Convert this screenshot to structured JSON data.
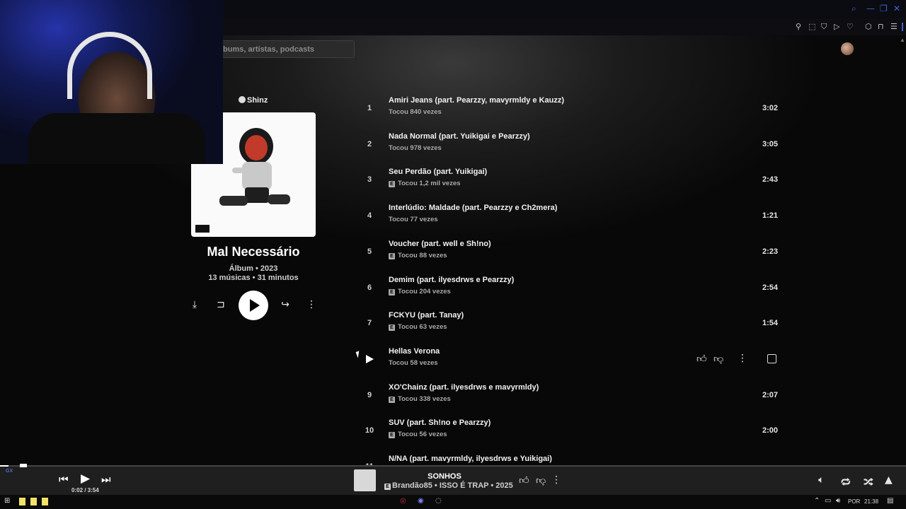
{
  "search": {
    "placeholder": "bums, artistas, podcasts"
  },
  "album": {
    "artist": "Shinz",
    "title": "Mal Necessário",
    "meta_type_year": "Álbum • 2023",
    "meta_count_duration": "13 músicas • 31 minutos",
    "advisory": "PARENTAL ADVISORY"
  },
  "tracks": [
    {
      "num": "1",
      "title": "Amiri Jeans (part. Pearzzy, mavyrmldy e Kauzz)",
      "plays": "Tocou 840 vezes",
      "explicit": false,
      "duration": "3:02"
    },
    {
      "num": "2",
      "title": "Nada Normal (part. Yuikigai e Pearzzy)",
      "plays": "Tocou 978 vezes",
      "explicit": false,
      "duration": "3:05"
    },
    {
      "num": "3",
      "title": "Seu Perdão (part. Yuikigai)",
      "plays": "Tocou 1,2 mil vezes",
      "explicit": true,
      "duration": "2:43"
    },
    {
      "num": "4",
      "title": "Interlúdio: Maldade (part. Pearzzy e Ch2mera)",
      "plays": "Tocou 77 vezes",
      "explicit": false,
      "duration": "1:21"
    },
    {
      "num": "5",
      "title": "Voucher (part. well e Sh!no)",
      "plays": "Tocou 88 vezes",
      "explicit": true,
      "duration": "2:23"
    },
    {
      "num": "6",
      "title": "Demim (part. ilyesdrws e Pearzzy)",
      "plays": "Tocou 204 vezes",
      "explicit": true,
      "duration": "2:54"
    },
    {
      "num": "7",
      "title": "FCKYU (part. Tanay)",
      "plays": "Tocou 63 vezes",
      "explicit": true,
      "duration": "1:54"
    },
    {
      "num": "",
      "title": "Hellas Verona",
      "plays": "Tocou 58 vezes",
      "explicit": false,
      "duration": ""
    },
    {
      "num": "9",
      "title": "XO'Chainz (part. ilyesdrws e mavyrmldy)",
      "plays": "Tocou 338 vezes",
      "explicit": true,
      "duration": "2:07"
    },
    {
      "num": "10",
      "title": "SUV (part. Sh!no e Pearzzy)",
      "plays": "Tocou 56 vezes",
      "explicit": true,
      "duration": "2:00"
    },
    {
      "num": "11",
      "title": "N/NA (part. mavyrmldy, ilyesdrws e Yuikigai)",
      "plays": "",
      "explicit": false,
      "duration": ""
    }
  ],
  "explicit_badge": "E",
  "player": {
    "time": "0:02 / 3:54",
    "progress_fraction": 0.009,
    "song_title": "SONHOS",
    "song_subtitle": "Brandão85 • ISSO É TRAP • 2025"
  },
  "taskbar": {
    "lang": "POR",
    "clock": "21:38"
  },
  "overlay": {
    "gx": "GX"
  },
  "icons": {
    "window": [
      "search-icon",
      "minimize-icon",
      "restore-icon",
      "close-icon"
    ],
    "row_hover": [
      "thumbs-up-icon",
      "thumbs-down-icon",
      "more-vert-icon",
      "checkbox-icon"
    ],
    "album_actions": [
      "download-icon",
      "bookmark-icon",
      "play-icon",
      "share-icon",
      "more-vert-icon"
    ]
  },
  "colors": {
    "accent": "#3a63d6",
    "background": "#000000",
    "player_bar": "#1f1f1f"
  }
}
